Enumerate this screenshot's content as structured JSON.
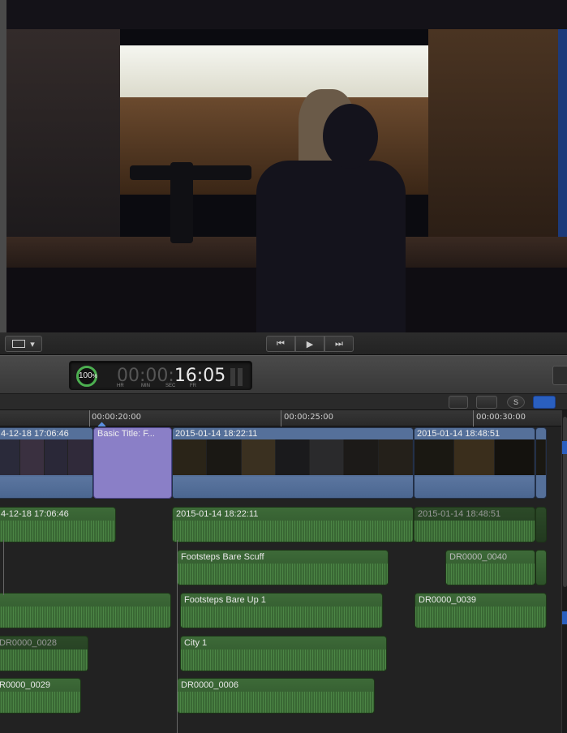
{
  "viewer": {
    "transport": {
      "prev_label": "⏮",
      "play_label": "▶",
      "next_label": "⏭",
      "view_menu_label": "▾"
    }
  },
  "dashboard": {
    "percent": "100",
    "percent_unit": "%",
    "timecode_dim": "00:00:",
    "timecode_bright": "16:05",
    "timecode_tail": "",
    "labels": [
      "HR",
      "MIN",
      "SEC",
      "FR"
    ]
  },
  "ruler": {
    "ticks": [
      "00:00:20:00",
      "00:00:25:00",
      "00:00:30:00"
    ]
  },
  "tracks": {
    "video": [
      {
        "title": "4-12-18 17:06:46"
      },
      {
        "title": "Basic Title: F..."
      },
      {
        "title": "2015-01-14 18:22:11"
      },
      {
        "title": "2015-01-14 18:48:51"
      }
    ],
    "audio": [
      {
        "title": "4-12-18 17:06:46"
      },
      {
        "title": "2015-01-14 18:22:11"
      },
      {
        "title": "2015-01-14 18:48:51"
      },
      {
        "title": "Footsteps Bare Scuff"
      },
      {
        "title": "DR0000_0040"
      },
      {
        "title": ""
      },
      {
        "title": "Footsteps Bare Up 1"
      },
      {
        "title": "DR0000_0039"
      },
      {
        "title": "DR0000_0028"
      },
      {
        "title": "City 1"
      },
      {
        "title": "R0000_0029"
      },
      {
        "title": "DR0000_0006"
      }
    ]
  },
  "colors": {
    "video_clip": "#55709a",
    "title_clip": "#8a7fc7",
    "audio_clip": "#3d6a38",
    "accent_blue": "#2a5fbf",
    "progress_green": "#4caf50"
  }
}
